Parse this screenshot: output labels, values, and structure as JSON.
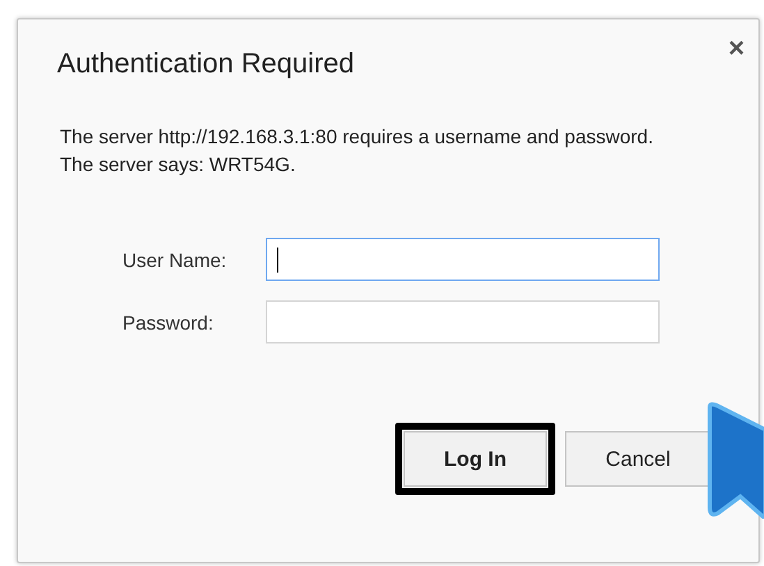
{
  "dialog": {
    "title": "Authentication Required",
    "close": "×",
    "message": "The server http://192.168.3.1:80 requires a username and password. The server says: WRT54G.",
    "fields": [
      {
        "label": "User Name:",
        "focused": true
      },
      {
        "label": "Password:",
        "focused": false
      }
    ],
    "buttons": [
      {
        "label": "Log In",
        "default": true,
        "highlighted": true
      },
      {
        "label": "Cancel",
        "default": false,
        "highlighted": false
      }
    ]
  }
}
